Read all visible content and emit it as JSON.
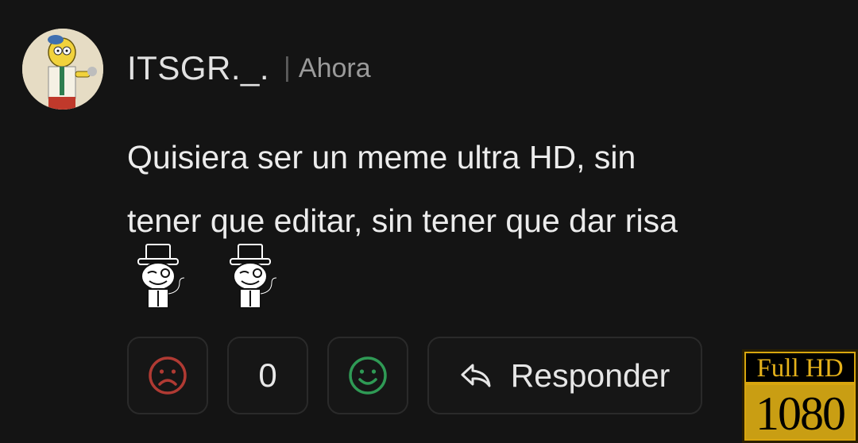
{
  "comment": {
    "username": "ITSGR._.",
    "separator": "|",
    "timestamp": "Ahora",
    "text_lines": [
      "Quisiera ser un meme ultra HD, sin",
      "tener que editar, sin tener que dar risa"
    ],
    "emotes": [
      "feel-like-a-sir-meme",
      "feel-like-a-sir-meme"
    ]
  },
  "actions": {
    "dislike_icon": "sad-face-icon",
    "vote_count": "0",
    "like_icon": "happy-face-icon",
    "reply_icon": "reply-arrow-icon",
    "reply_label": "Responder"
  },
  "watermark": {
    "top": "Full HD",
    "bottom": "1080"
  },
  "colors": {
    "background": "#141414",
    "dislike": "#b03a33",
    "like": "#2f9a55",
    "badge_gold": "#d8a60f"
  }
}
